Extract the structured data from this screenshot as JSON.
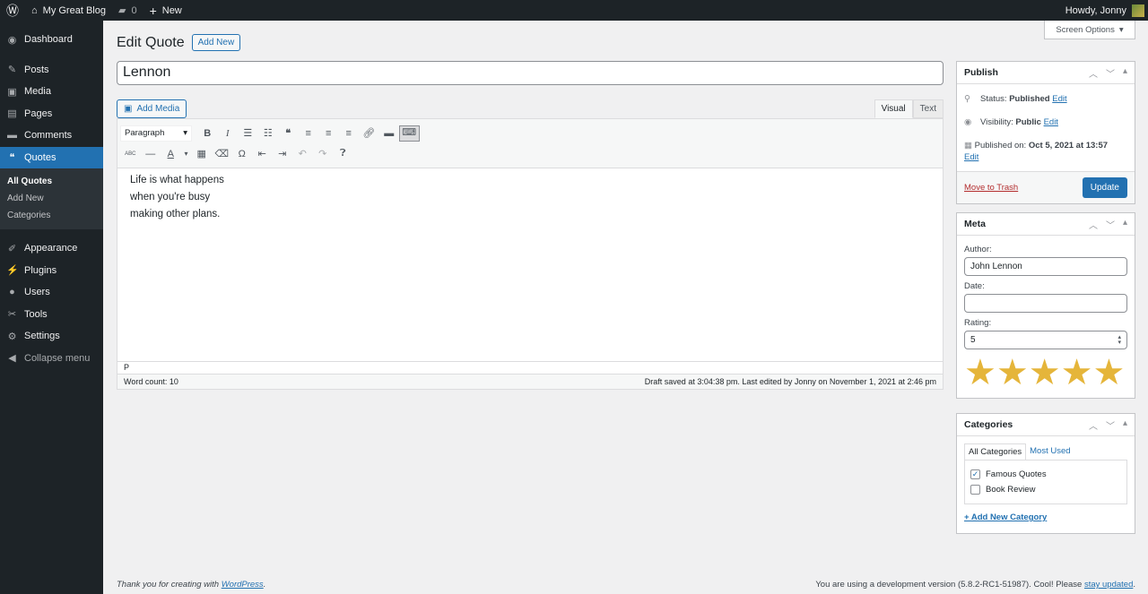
{
  "adminbar": {
    "site": "My Great Blog",
    "comments": "0",
    "new": "New",
    "howdy": "Howdy, Jonny"
  },
  "screen_options": "Screen Options",
  "sidebar": {
    "items": [
      {
        "label": "Dashboard",
        "icon": "dashboard-icon",
        "glyph": "◉"
      },
      {
        "label": "Posts",
        "icon": "pin-icon",
        "glyph": "✎"
      },
      {
        "label": "Media",
        "icon": "media-icon",
        "glyph": "▣"
      },
      {
        "label": "Pages",
        "icon": "pages-icon",
        "glyph": "▤"
      },
      {
        "label": "Comments",
        "icon": "comment-icon",
        "glyph": "▬"
      },
      {
        "label": "Quotes",
        "icon": "quote-icon",
        "glyph": "❝"
      },
      {
        "label": "Appearance",
        "icon": "brush-icon",
        "glyph": "✐"
      },
      {
        "label": "Plugins",
        "icon": "plugin-icon",
        "glyph": "⚡"
      },
      {
        "label": "Users",
        "icon": "user-icon",
        "glyph": "●"
      },
      {
        "label": "Tools",
        "icon": "wrench-icon",
        "glyph": "✂"
      },
      {
        "label": "Settings",
        "icon": "settings-icon",
        "glyph": "⚙"
      }
    ],
    "submenu": [
      "All Quotes",
      "Add New",
      "Categories"
    ],
    "collapse": "Collapse menu"
  },
  "page": {
    "title": "Edit Quote",
    "add_new": "Add New",
    "post_title": "Lennon"
  },
  "editor": {
    "add_media": "Add Media",
    "tab_visual": "Visual",
    "tab_text": "Text",
    "format": "Paragraph",
    "lines": [
      "Life is what happens",
      "when you're busy",
      "making other plans."
    ],
    "path": "P",
    "word_count": "Word count: 10",
    "draft_status": "Draft saved at 3:04:38 pm. Last edited by Jonny on November 1, 2021 at 2:46 pm"
  },
  "publish": {
    "title": "Publish",
    "status_label": "Status:",
    "status": "Published",
    "visibility_label": "Visibility:",
    "visibility": "Public",
    "published_label": "Published on:",
    "published": "Oct 5, 2021 at 13:57",
    "edit": "Edit",
    "trash": "Move to Trash",
    "update": "Update"
  },
  "meta": {
    "title": "Meta",
    "author_label": "Author:",
    "author": "John Lennon",
    "date_label": "Date:",
    "date": "",
    "rating_label": "Rating:",
    "rating": "5",
    "rating_max": 5
  },
  "categories": {
    "title": "Categories",
    "tab_all": "All Categories",
    "tab_most": "Most Used",
    "items": [
      {
        "label": "Famous Quotes",
        "checked": true
      },
      {
        "label": "Book Review",
        "checked": false
      }
    ],
    "add": "+ Add New Category"
  },
  "footer": {
    "thanks": "Thank you for creating with ",
    "wp": "WordPress",
    "thanks_end": ".",
    "version": "You are using a development version (5.8.2-RC1-51987). Cool! Please ",
    "stay": "stay updated",
    "version_end": "."
  },
  "colors": {
    "accent": "#2271b1",
    "adminbar": "#1d2327",
    "star": "#e5b53a",
    "trash": "#b32d2e"
  }
}
